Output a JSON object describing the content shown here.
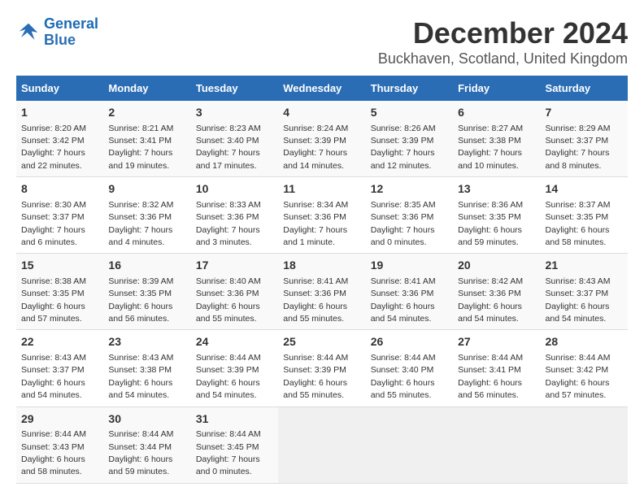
{
  "header": {
    "logo_line1": "General",
    "logo_line2": "Blue",
    "month": "December 2024",
    "location": "Buckhaven, Scotland, United Kingdom"
  },
  "days_of_week": [
    "Sunday",
    "Monday",
    "Tuesday",
    "Wednesday",
    "Thursday",
    "Friday",
    "Saturday"
  ],
  "weeks": [
    [
      {
        "day": "1",
        "sunrise": "Sunrise: 8:20 AM",
        "sunset": "Sunset: 3:42 PM",
        "daylight": "Daylight: 7 hours and 22 minutes."
      },
      {
        "day": "2",
        "sunrise": "Sunrise: 8:21 AM",
        "sunset": "Sunset: 3:41 PM",
        "daylight": "Daylight: 7 hours and 19 minutes."
      },
      {
        "day": "3",
        "sunrise": "Sunrise: 8:23 AM",
        "sunset": "Sunset: 3:40 PM",
        "daylight": "Daylight: 7 hours and 17 minutes."
      },
      {
        "day": "4",
        "sunrise": "Sunrise: 8:24 AM",
        "sunset": "Sunset: 3:39 PM",
        "daylight": "Daylight: 7 hours and 14 minutes."
      },
      {
        "day": "5",
        "sunrise": "Sunrise: 8:26 AM",
        "sunset": "Sunset: 3:39 PM",
        "daylight": "Daylight: 7 hours and 12 minutes."
      },
      {
        "day": "6",
        "sunrise": "Sunrise: 8:27 AM",
        "sunset": "Sunset: 3:38 PM",
        "daylight": "Daylight: 7 hours and 10 minutes."
      },
      {
        "day": "7",
        "sunrise": "Sunrise: 8:29 AM",
        "sunset": "Sunset: 3:37 PM",
        "daylight": "Daylight: 7 hours and 8 minutes."
      }
    ],
    [
      {
        "day": "8",
        "sunrise": "Sunrise: 8:30 AM",
        "sunset": "Sunset: 3:37 PM",
        "daylight": "Daylight: 7 hours and 6 minutes."
      },
      {
        "day": "9",
        "sunrise": "Sunrise: 8:32 AM",
        "sunset": "Sunset: 3:36 PM",
        "daylight": "Daylight: 7 hours and 4 minutes."
      },
      {
        "day": "10",
        "sunrise": "Sunrise: 8:33 AM",
        "sunset": "Sunset: 3:36 PM",
        "daylight": "Daylight: 7 hours and 3 minutes."
      },
      {
        "day": "11",
        "sunrise": "Sunrise: 8:34 AM",
        "sunset": "Sunset: 3:36 PM",
        "daylight": "Daylight: 7 hours and 1 minute."
      },
      {
        "day": "12",
        "sunrise": "Sunrise: 8:35 AM",
        "sunset": "Sunset: 3:36 PM",
        "daylight": "Daylight: 7 hours and 0 minutes."
      },
      {
        "day": "13",
        "sunrise": "Sunrise: 8:36 AM",
        "sunset": "Sunset: 3:35 PM",
        "daylight": "Daylight: 6 hours and 59 minutes."
      },
      {
        "day": "14",
        "sunrise": "Sunrise: 8:37 AM",
        "sunset": "Sunset: 3:35 PM",
        "daylight": "Daylight: 6 hours and 58 minutes."
      }
    ],
    [
      {
        "day": "15",
        "sunrise": "Sunrise: 8:38 AM",
        "sunset": "Sunset: 3:35 PM",
        "daylight": "Daylight: 6 hours and 57 minutes."
      },
      {
        "day": "16",
        "sunrise": "Sunrise: 8:39 AM",
        "sunset": "Sunset: 3:35 PM",
        "daylight": "Daylight: 6 hours and 56 minutes."
      },
      {
        "day": "17",
        "sunrise": "Sunrise: 8:40 AM",
        "sunset": "Sunset: 3:36 PM",
        "daylight": "Daylight: 6 hours and 55 minutes."
      },
      {
        "day": "18",
        "sunrise": "Sunrise: 8:41 AM",
        "sunset": "Sunset: 3:36 PM",
        "daylight": "Daylight: 6 hours and 55 minutes."
      },
      {
        "day": "19",
        "sunrise": "Sunrise: 8:41 AM",
        "sunset": "Sunset: 3:36 PM",
        "daylight": "Daylight: 6 hours and 54 minutes."
      },
      {
        "day": "20",
        "sunrise": "Sunrise: 8:42 AM",
        "sunset": "Sunset: 3:36 PM",
        "daylight": "Daylight: 6 hours and 54 minutes."
      },
      {
        "day": "21",
        "sunrise": "Sunrise: 8:43 AM",
        "sunset": "Sunset: 3:37 PM",
        "daylight": "Daylight: 6 hours and 54 minutes."
      }
    ],
    [
      {
        "day": "22",
        "sunrise": "Sunrise: 8:43 AM",
        "sunset": "Sunset: 3:37 PM",
        "daylight": "Daylight: 6 hours and 54 minutes."
      },
      {
        "day": "23",
        "sunrise": "Sunrise: 8:43 AM",
        "sunset": "Sunset: 3:38 PM",
        "daylight": "Daylight: 6 hours and 54 minutes."
      },
      {
        "day": "24",
        "sunrise": "Sunrise: 8:44 AM",
        "sunset": "Sunset: 3:39 PM",
        "daylight": "Daylight: 6 hours and 54 minutes."
      },
      {
        "day": "25",
        "sunrise": "Sunrise: 8:44 AM",
        "sunset": "Sunset: 3:39 PM",
        "daylight": "Daylight: 6 hours and 55 minutes."
      },
      {
        "day": "26",
        "sunrise": "Sunrise: 8:44 AM",
        "sunset": "Sunset: 3:40 PM",
        "daylight": "Daylight: 6 hours and 55 minutes."
      },
      {
        "day": "27",
        "sunrise": "Sunrise: 8:44 AM",
        "sunset": "Sunset: 3:41 PM",
        "daylight": "Daylight: 6 hours and 56 minutes."
      },
      {
        "day": "28",
        "sunrise": "Sunrise: 8:44 AM",
        "sunset": "Sunset: 3:42 PM",
        "daylight": "Daylight: 6 hours and 57 minutes."
      }
    ],
    [
      {
        "day": "29",
        "sunrise": "Sunrise: 8:44 AM",
        "sunset": "Sunset: 3:43 PM",
        "daylight": "Daylight: 6 hours and 58 minutes."
      },
      {
        "day": "30",
        "sunrise": "Sunrise: 8:44 AM",
        "sunset": "Sunset: 3:44 PM",
        "daylight": "Daylight: 6 hours and 59 minutes."
      },
      {
        "day": "31",
        "sunrise": "Sunrise: 8:44 AM",
        "sunset": "Sunset: 3:45 PM",
        "daylight": "Daylight: 7 hours and 0 minutes."
      },
      null,
      null,
      null,
      null
    ]
  ]
}
